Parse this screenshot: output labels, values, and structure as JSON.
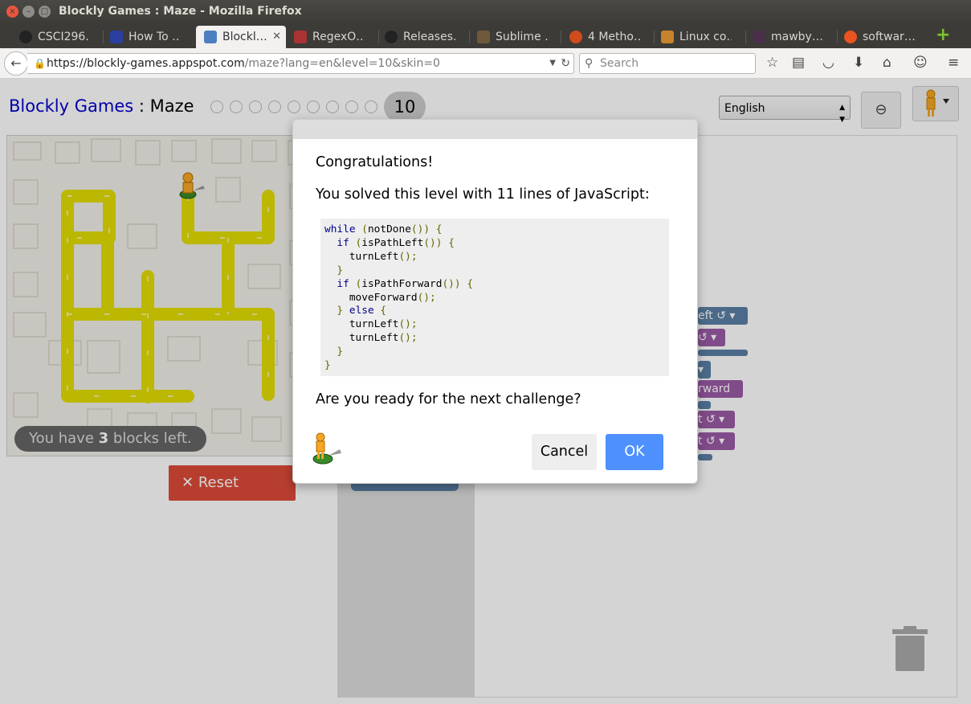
{
  "window": {
    "title": "Blockly Games : Maze - Mozilla Firefox"
  },
  "tabs": [
    {
      "label": "CSCI296…",
      "icon": "github-icon",
      "active": false
    },
    {
      "label": "How To …",
      "icon": "site-icon",
      "active": false
    },
    {
      "label": "Blockl…",
      "icon": "puzzle-icon",
      "active": true
    },
    {
      "label": "RegexO…",
      "icon": "regex-icon",
      "active": false
    },
    {
      "label": "Releases…",
      "icon": "github-icon",
      "active": false
    },
    {
      "label": "Sublime …",
      "icon": "sublime-icon",
      "active": false
    },
    {
      "label": "4 Metho…",
      "icon": "ubuntu-icon",
      "active": false
    },
    {
      "label": "Linux co…",
      "icon": "stack-icon",
      "active": false
    },
    {
      "label": "mawby…",
      "icon": "hash-icon",
      "active": false
    },
    {
      "label": "softwar…",
      "icon": "askubuntu-icon",
      "active": false
    }
  ],
  "nav": {
    "url_host": "https://blockly-games.appspot.com",
    "url_path": "/maze?lang=en&level=10&skin=0",
    "search_placeholder": "Search"
  },
  "header": {
    "app_name": "Blockly Games",
    "separator": " : ",
    "page_name": "Maze",
    "current_level": "10",
    "language": "English"
  },
  "maze": {
    "blocks_left_prefix": "You have ",
    "blocks_left_count": "3",
    "blocks_left_suffix": " blocks left.",
    "reset_label": "Reset"
  },
  "workspace": {
    "blocks": [
      {
        "label": "eft ↺ ▾"
      },
      {
        "label": "↺ ▾"
      },
      {
        "label": "▾"
      },
      {
        "label": "rward"
      },
      {
        "label": "t ↺ ▾"
      },
      {
        "label": "t ↺ ▾"
      }
    ]
  },
  "dialog": {
    "congrats": "Congratulations!",
    "solved": "You solved this level with 11 lines of JavaScript:",
    "code_lines": [
      "while (notDone()) {",
      "  if (isPathLeft()) {",
      "    turnLeft();",
      "  }",
      "  if (isPathForward()) {",
      "    moveForward();",
      "  } else {",
      "    turnLeft();",
      "    turnLeft();",
      "  }",
      "}"
    ],
    "ready": "Are you ready for the next challenge?",
    "cancel_label": "Cancel",
    "ok_label": "OK"
  },
  "colors": {
    "ok_blue": "#4d90fe",
    "reset_red": "#dd4b39",
    "path_yellow": "#e2dc00",
    "block_purple": "#9a5ba5",
    "block_blue": "#5b80a5"
  }
}
